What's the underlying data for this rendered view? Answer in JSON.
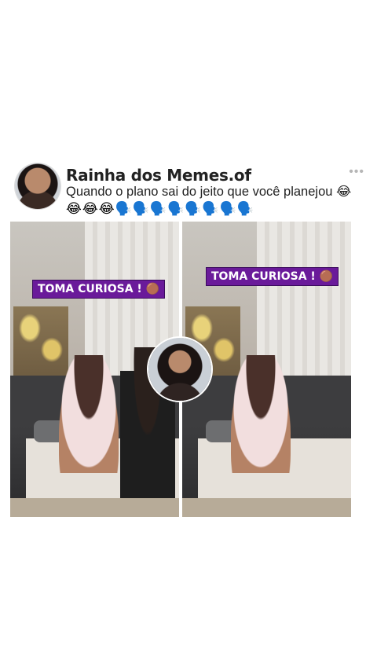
{
  "post": {
    "account_name": "Rainha dos Memes.of",
    "caption": "Quando o plano sai do jeito que você planejou 😂",
    "emoji_line": "😂😂😂🗣️🗣️🗣️🗣️🗣️🗣️🗣️🗣️",
    "more_icon": "•••"
  },
  "media": {
    "left_label": "TOMA CURIOSA ! 🟤",
    "right_label": "TOMA CURIOSA ! 🟤"
  }
}
